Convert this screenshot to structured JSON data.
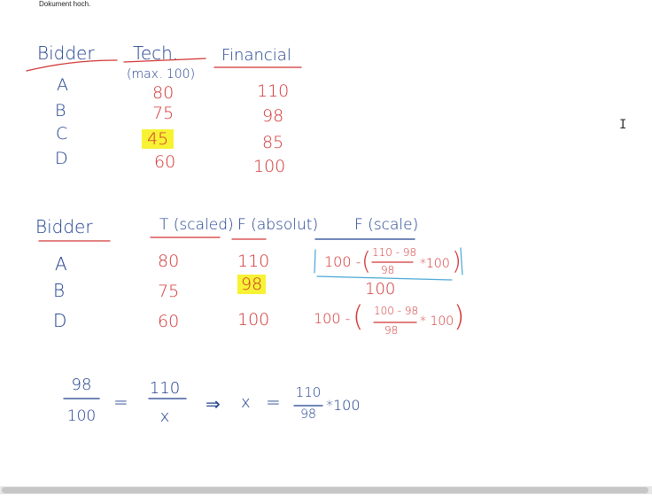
{
  "top_text": "Dokument hoch.",
  "colors": {
    "blue_ink": "#1c3d8c",
    "red_ink": "#d23434",
    "highlight": "#f7f233"
  },
  "table1": {
    "headers": {
      "bidder": "Bidder",
      "tech": "Tech.",
      "tech_sub": "(max. 100)",
      "financial": "Financial"
    },
    "rows": [
      {
        "bidder": "A",
        "tech": "80",
        "fin": "110"
      },
      {
        "bidder": "B",
        "tech": "75",
        "fin": "98"
      },
      {
        "bidder": "C",
        "tech": "45",
        "fin": "85"
      },
      {
        "bidder": "D",
        "tech": "60",
        "fin": "100"
      }
    ]
  },
  "table2": {
    "headers": {
      "bidder": "Bidder",
      "t_scaled": "T (scaled)",
      "f_absolut": "F (absolut)",
      "f_scale": "F (scale)"
    },
    "rows": [
      {
        "bidder": "A",
        "t": "80",
        "f": "110",
        "calc_prefix": "100 -",
        "calc_num": "110 - 98",
        "calc_den": "98",
        "calc_suffix": "*100"
      },
      {
        "bidder": "B",
        "t": "75",
        "f": "98",
        "calc_value": "100"
      },
      {
        "bidder": "D",
        "t": "60",
        "f": "100",
        "calc_prefix": "100 -",
        "calc_num": "100 - 98",
        "calc_den": "98",
        "calc_suffix": "* 100"
      }
    ]
  },
  "equation": {
    "f1_num": "98",
    "f1_den": "100",
    "eq": "=",
    "f2_num": "110",
    "f2_den": "x",
    "arrow": "⇒",
    "x": "x",
    "eq2": "=",
    "f3_num": "110",
    "f3_den": "98",
    "suffix": "*100"
  }
}
